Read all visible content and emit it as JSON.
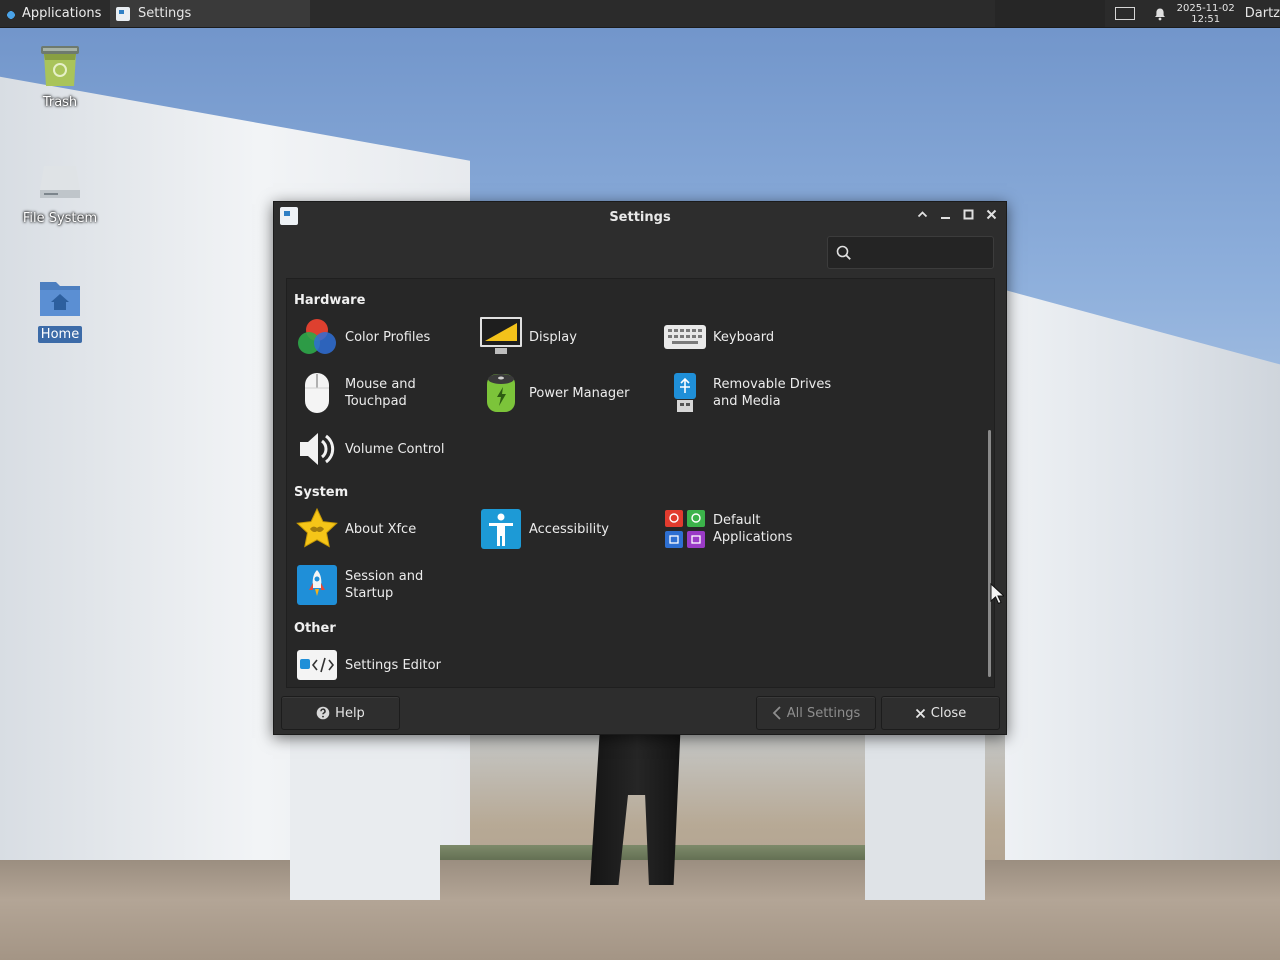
{
  "panel": {
    "apps_menu_label": "Applications",
    "task_title": "Settings",
    "clock_date": "2025-11-02",
    "clock_time": "12:51",
    "user": "Dartz"
  },
  "desktop": {
    "icons": [
      {
        "label": "Trash",
        "icon": "trash-icon"
      },
      {
        "label": "File System",
        "icon": "drive-icon"
      },
      {
        "label": "Home",
        "icon": "home-folder-icon"
      }
    ]
  },
  "window": {
    "title": "Settings",
    "search_placeholder": "",
    "sections": [
      {
        "title": "Hardware",
        "items": [
          {
            "label": "Color Profiles",
            "icon": "color-profiles-icon"
          },
          {
            "label": "Display",
            "icon": "display-icon"
          },
          {
            "label": "Keyboard",
            "icon": "keyboard-icon"
          },
          {
            "label": "Mouse and\nTouchpad",
            "icon": "mouse-icon"
          },
          {
            "label": "Power Manager",
            "icon": "battery-icon"
          },
          {
            "label": "Removable Drives\nand Media",
            "icon": "usb-drive-icon"
          },
          {
            "label": "Volume Control",
            "icon": "speaker-icon"
          }
        ]
      },
      {
        "title": "System",
        "items": [
          {
            "label": "About Xfce",
            "icon": "star-icon"
          },
          {
            "label": "Accessibility",
            "icon": "accessibility-icon"
          },
          {
            "label": "Default\nApplications",
            "icon": "default-apps-icon"
          },
          {
            "label": "Session and\nStartup",
            "icon": "rocket-icon"
          }
        ]
      },
      {
        "title": "Other",
        "items": [
          {
            "label": "Settings Editor",
            "icon": "code-icon"
          }
        ]
      }
    ],
    "footer": {
      "help_label": "Help",
      "all_settings_label": "All Settings",
      "close_label": "Close"
    }
  },
  "colors": {
    "panel_bg": "#2b2b2b",
    "window_bg": "#2d2d2d",
    "accent": "#3c6ba8"
  }
}
